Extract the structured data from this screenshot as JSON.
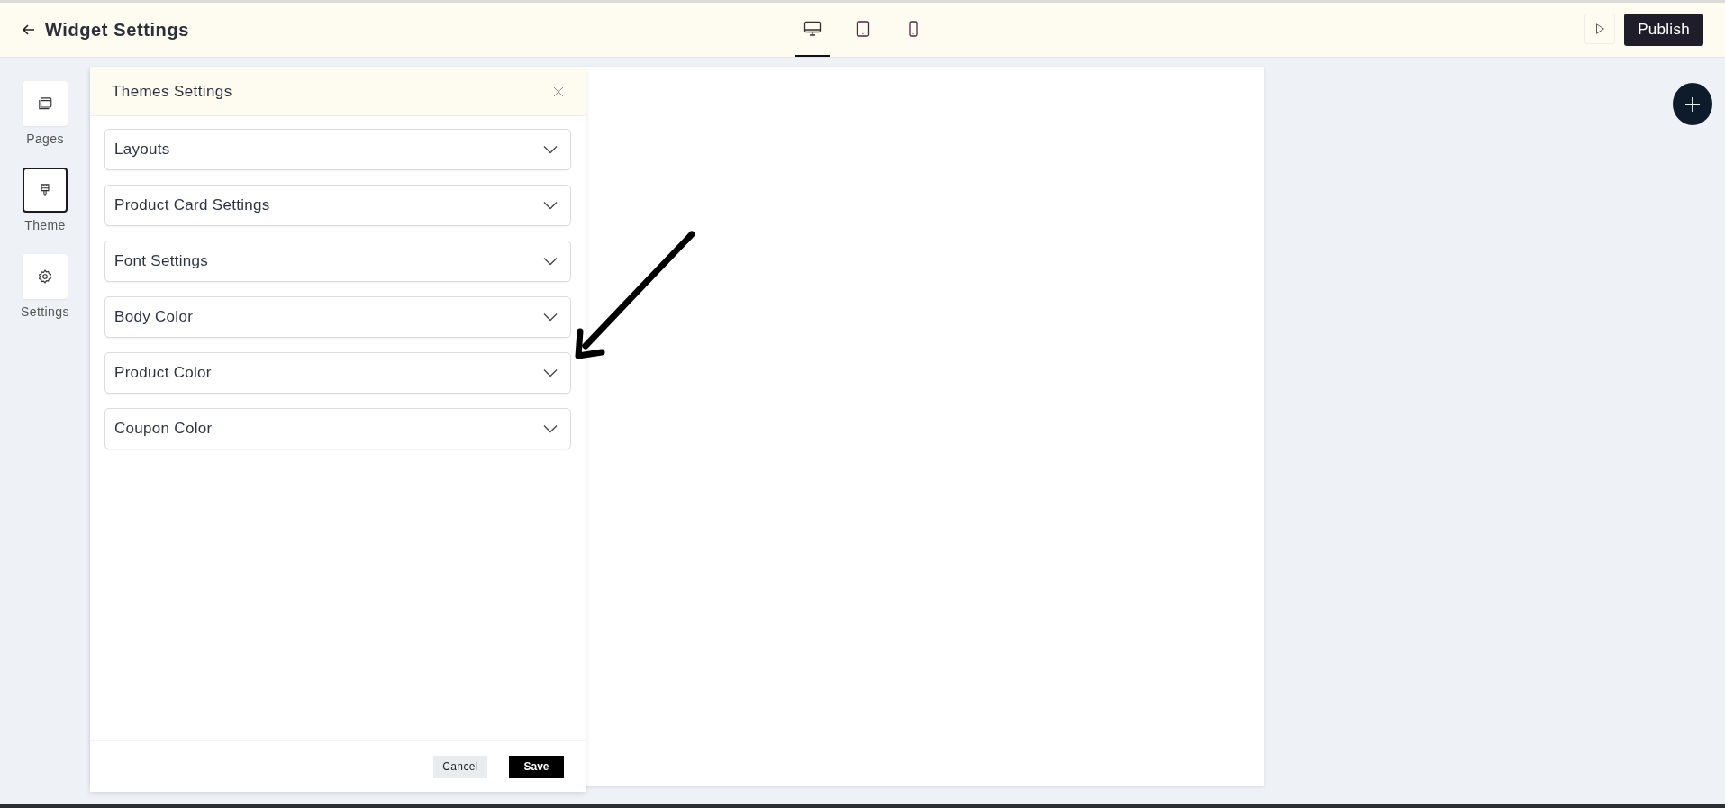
{
  "header": {
    "title": "Widget Settings",
    "devices": [
      {
        "kind": "desktop",
        "selected": true
      },
      {
        "kind": "tablet",
        "selected": false
      },
      {
        "kind": "mobile",
        "selected": false
      }
    ],
    "publish": "Publish"
  },
  "sidebar": {
    "items": [
      {
        "kind": "pages",
        "label": "Pages",
        "selected": false
      },
      {
        "kind": "theme",
        "label": "Theme",
        "selected": true
      },
      {
        "kind": "settings",
        "label": "Settings",
        "selected": false
      }
    ]
  },
  "panel": {
    "title": "Themes Settings",
    "sections": [
      {
        "label": "Layouts",
        "expanded": false
      },
      {
        "label": "Product Card Settings",
        "expanded": false
      },
      {
        "label": "Font Settings",
        "expanded": false
      },
      {
        "label": "Body Color",
        "expanded": false
      },
      {
        "label": "Product Color",
        "expanded": false
      },
      {
        "label": "Coupon Color",
        "expanded": false
      }
    ],
    "cancel": "Cancel",
    "save": "Save"
  }
}
